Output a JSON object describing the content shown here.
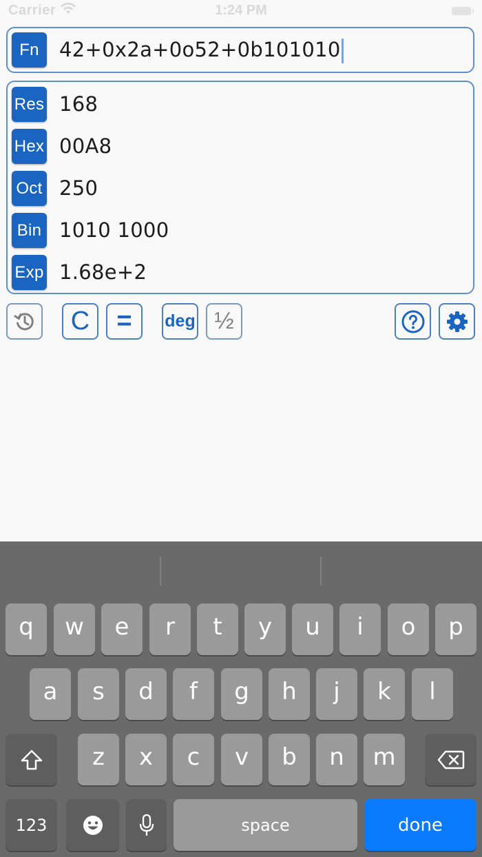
{
  "status": {
    "carrier": "Carrier",
    "time": "1:24 PM"
  },
  "function": {
    "tag": "Fn",
    "expression": "42+0x2a+0o52+0b101010"
  },
  "results": [
    {
      "tag": "Res",
      "value": "168"
    },
    {
      "tag": "Hex",
      "value": "00A8"
    },
    {
      "tag": "Oct",
      "value": "250"
    },
    {
      "tag": "Bin",
      "value": "1010 1000"
    },
    {
      "tag": "Exp",
      "value": "1.68e+2"
    }
  ],
  "toolbar": {
    "history_icon": "history-icon",
    "clear_label": "C",
    "equals_label": "=",
    "angle_label": "deg",
    "fraction_label": "½",
    "help_icon": "help-icon",
    "settings_icon": "gear-icon"
  },
  "keyboard": {
    "row1": [
      "q",
      "w",
      "e",
      "r",
      "t",
      "y",
      "u",
      "i",
      "o",
      "p"
    ],
    "row2": [
      "a",
      "s",
      "d",
      "f",
      "g",
      "h",
      "j",
      "k",
      "l"
    ],
    "row3": [
      "z",
      "x",
      "c",
      "v",
      "b",
      "n",
      "m"
    ],
    "numbers_label": "123",
    "space_label": "space",
    "done_label": "done"
  },
  "colors": {
    "accent": "#1a64c2",
    "panel_border": "#5b8fcf",
    "keyboard_bg": "#6a6a6a",
    "key_bg": "#9a9a9a",
    "done_key": "#0a7bff"
  }
}
